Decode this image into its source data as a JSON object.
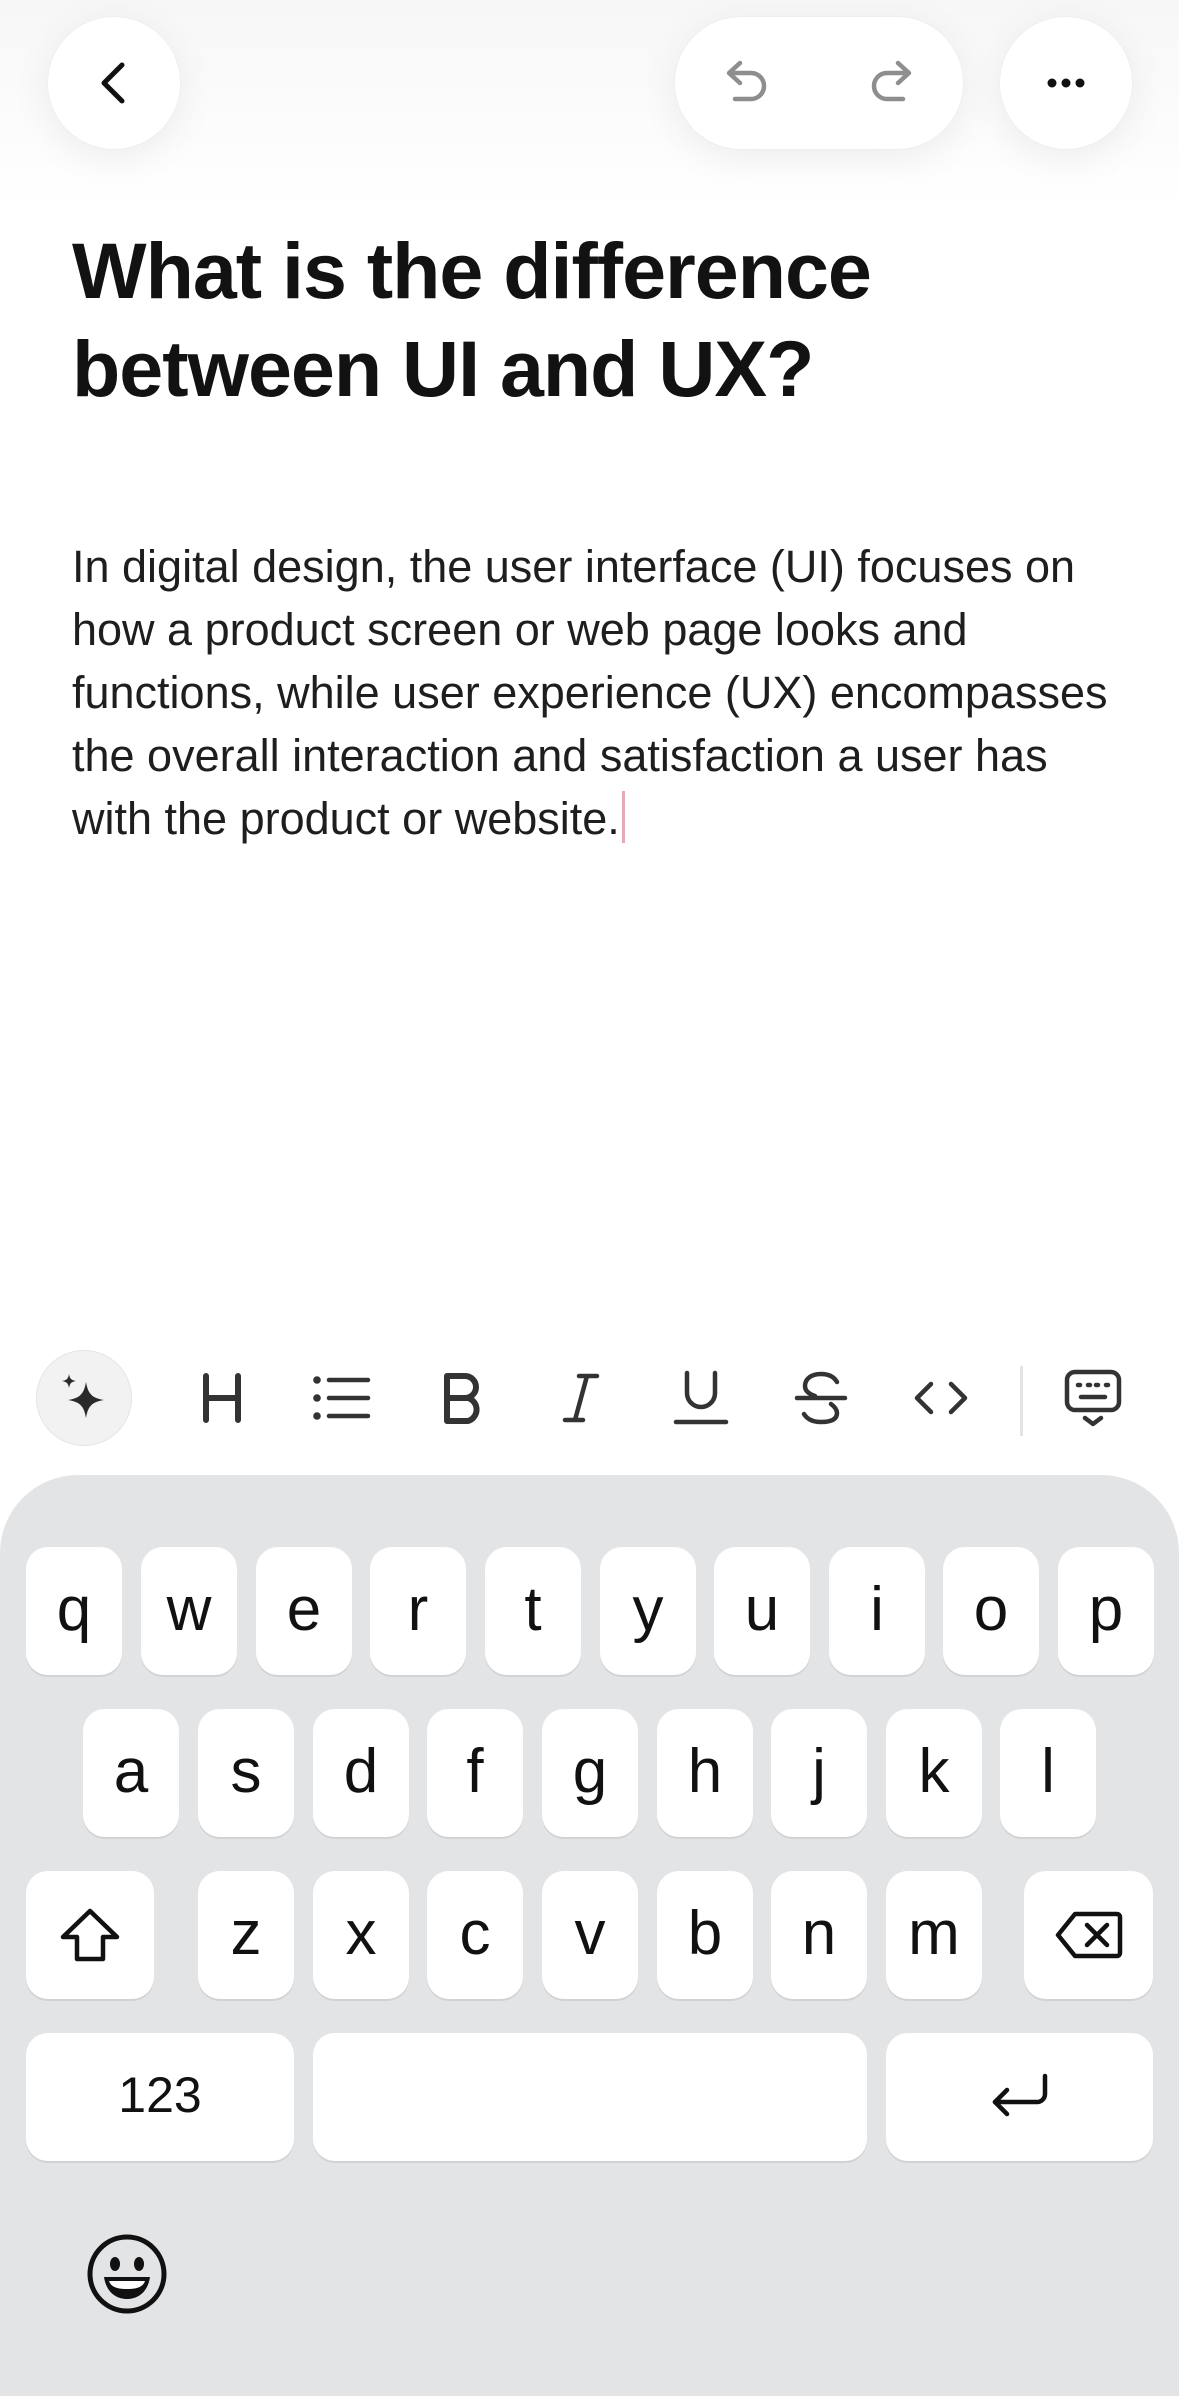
{
  "header": {
    "back_icon": "chevron-left-icon",
    "undo_icon": "undo-icon",
    "redo_icon": "redo-icon",
    "more_icon": "ellipsis-icon"
  },
  "document": {
    "title": "What is the difference between UI and UX?",
    "body": "In digital design, the user interface (UI) focuses on how a product screen or web page looks and functions, while user experience (UX) encompasses the overall interaction and satisfaction a user has with the product or website."
  },
  "toolbar": {
    "items": [
      {
        "name": "ai-assist",
        "icon": "sparkles-icon"
      },
      {
        "name": "heading",
        "icon": "heading-icon"
      },
      {
        "name": "bullet-list",
        "icon": "list-icon"
      },
      {
        "name": "bold",
        "icon": "bold-icon"
      },
      {
        "name": "italic",
        "icon": "italic-icon"
      },
      {
        "name": "underline",
        "icon": "underline-icon"
      },
      {
        "name": "strikethrough",
        "icon": "strikethrough-icon"
      },
      {
        "name": "code",
        "icon": "code-icon"
      },
      {
        "name": "hide-keyboard",
        "icon": "keyboard-dismiss-icon"
      }
    ]
  },
  "keyboard": {
    "row1": [
      "q",
      "w",
      "e",
      "r",
      "t",
      "y",
      "u",
      "i",
      "o",
      "p"
    ],
    "row2": [
      "a",
      "s",
      "d",
      "f",
      "g",
      "h",
      "j",
      "k",
      "l"
    ],
    "row3": [
      "z",
      "x",
      "c",
      "v",
      "b",
      "n",
      "m"
    ],
    "numbers_label": "123",
    "space_label": "",
    "shift_icon": "shift-icon",
    "delete_icon": "backspace-icon",
    "return_icon": "return-icon",
    "emoji_icon": "emoji-icon"
  },
  "colors": {
    "keyboard_bg": "#e3e4e6",
    "key_bg": "#ffffff",
    "caret": "#e7a9b6",
    "text": "#141414"
  }
}
